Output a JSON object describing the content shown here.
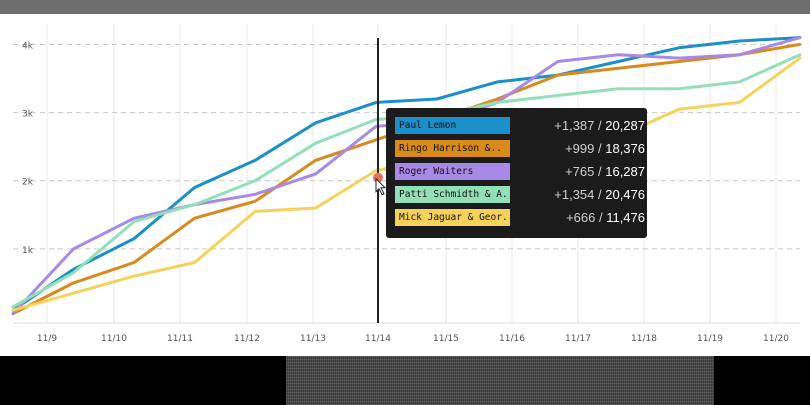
{
  "chart_data": {
    "type": "line",
    "x": [
      "11/9",
      "11/10",
      "11/11",
      "11/12",
      "11/13",
      "11/14",
      "11/15",
      "11/16",
      "11/17",
      "11/18",
      "11/19",
      "11/20"
    ],
    "y_ticks": [
      "1k",
      "2k",
      "3k",
      "4k"
    ],
    "ylim": [
      0,
      4300
    ],
    "grid": true,
    "series": [
      {
        "name": "Paul Lemon",
        "color": "#1a8fc9",
        "values": [
          100,
          700,
          1150,
          1900,
          2300,
          2850,
          3150,
          3200,
          3450,
          3550,
          3750,
          3950,
          4050,
          4100
        ]
      },
      {
        "name": "Ringo Harrison &..",
        "color": "#d98a1c",
        "values": [
          50,
          500,
          800,
          1450,
          1700,
          2300,
          2600,
          2900,
          3200,
          3550,
          3650,
          3750,
          3850,
          4000
        ]
      },
      {
        "name": "Roger Waiters",
        "color": "#a78ae6",
        "values": [
          50,
          1000,
          1450,
          1650,
          1800,
          2100,
          2800,
          2850,
          3150,
          3750,
          3850,
          3800,
          3850,
          4100
        ]
      },
      {
        "name": "Patti Schmidth & A..",
        "color": "#93e0b8",
        "values": [
          150,
          650,
          1400,
          1650,
          2000,
          2550,
          2900,
          2950,
          3150,
          3250,
          3350,
          3350,
          3450,
          3850
        ]
      },
      {
        "name": "Mick Jaguar & Geor..",
        "color": "#f7d25a",
        "values": [
          100,
          350,
          600,
          800,
          1550,
          1600,
          2150,
          2300,
          2400,
          2600,
          2650,
          3050,
          3150,
          3800
        ]
      }
    ],
    "hover_x": "11/14",
    "tooltip": [
      {
        "name": "Paul Lemon",
        "delta": "+1,387",
        "total": "20,287"
      },
      {
        "name": "Ringo Harrison &..",
        "delta": "+999",
        "total": "18,376"
      },
      {
        "name": "Roger Waiters",
        "delta": "+765",
        "total": "16,287"
      },
      {
        "name": "Patti Schmidth & A..",
        "delta": "+1,354",
        "total": "20,476"
      },
      {
        "name": "Mick Jaguar & Geor..",
        "delta": "+666",
        "total": "11,476"
      }
    ]
  }
}
